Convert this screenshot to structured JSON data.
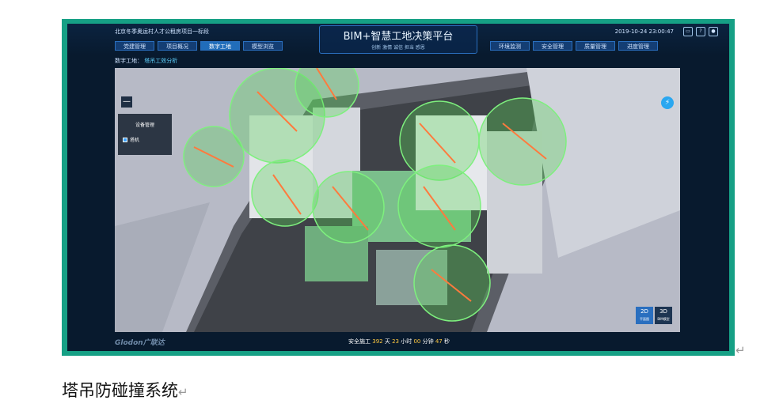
{
  "header": {
    "project_name": "北京冬季奥运村人才公租房项目一标段",
    "title": "BIM+智慧工地决策平台",
    "subtitle": "创新 激情 诚信 担当 感恩",
    "datetime": "2019-10-24 23:00:47",
    "nav_left": [
      "党建管理",
      "项目概况",
      "数字工地",
      "模型浏览"
    ],
    "nav_right": [
      "环境监测",
      "安全管理",
      "质量管理",
      "进度管理"
    ]
  },
  "breadcrumb": {
    "root": "数字工地：",
    "current": "塔吊工效分析"
  },
  "device_panel": {
    "title": "设备管理",
    "item": "塔机",
    "collapse_label": "—"
  },
  "view_toggle": {
    "two_d": "2D",
    "two_d_sub": "平面图",
    "three_d": "3D",
    "three_d_sub": "BIM模型"
  },
  "footer": {
    "logo": "Glodon广联达",
    "prefix": "安全施工 ",
    "days": "392",
    "days_unit": " 天 ",
    "hours": "23",
    "hours_unit": " 小时 ",
    "minutes": "00",
    "minutes_unit": " 分钟 ",
    "seconds": "47",
    "seconds_unit": " 秒"
  },
  "caption": "塔吊防碰撞系统",
  "paragraph_mark": "↵",
  "colors": {
    "frame": "#16a085",
    "accent": "#2aa7f0",
    "crane_zone": "#59d359"
  }
}
